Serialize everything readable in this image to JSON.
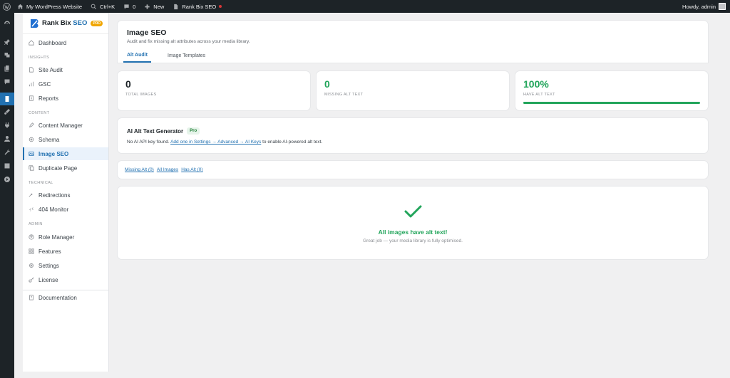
{
  "adminbar": {
    "site_name": "My WordPress Website",
    "shortcut": "Ctrl+K",
    "comments_count": "0",
    "new_label": "New",
    "plugin_label": "Rank Bix SEO",
    "howdy": "Howdy, admin"
  },
  "brand": {
    "name": "Rank Bix",
    "seo": "SEO",
    "pro": "PRO"
  },
  "sidebar": {
    "dashboard": "Dashboard",
    "section_insights": "INSIGHTS",
    "site_audit": "Site Audit",
    "gsc": "GSC",
    "reports": "Reports",
    "section_content": "CONTENT",
    "content_manager": "Content Manager",
    "schema": "Schema",
    "image_seo": "Image SEO",
    "duplicate_page": "Duplicate Page",
    "section_technical": "TECHNICAL",
    "redirections": "Redirections",
    "monitor_404": "404 Monitor",
    "section_admin": "ADMIN",
    "role_manager": "Role Manager",
    "features": "Features",
    "settings": "Settings",
    "license": "License",
    "documentation": "Documentation"
  },
  "header": {
    "title": "Image SEO",
    "subtitle": "Audit and fix missing alt attributes across your media library.",
    "tab_alt_audit": "Alt Audit",
    "tab_image_templates": "Image Templates"
  },
  "stats": {
    "total_images": {
      "value": "0",
      "label": "TOTAL IMAGES"
    },
    "missing_alt": {
      "value": "0",
      "label": "MISSING ALT TEXT"
    },
    "have_alt": {
      "value": "100%",
      "label": "HAVE ALT TEXT",
      "progress": 100
    }
  },
  "ai": {
    "title": "AI Alt Text Generator",
    "badge": "Pro",
    "text_before": "No AI API key found.",
    "link": "Add one in Settings → Advanced → AI Keys",
    "text_after": "to enable AI-powered alt text."
  },
  "filters": {
    "missing": "Missing Alt (0)",
    "all": "All Images",
    "has": "Has Alt (0)"
  },
  "empty": {
    "title": "All images have alt text!",
    "subtitle": "Great job — your media library is fully optimised."
  },
  "colors": {
    "accent": "#2271b1",
    "success": "#22a55b",
    "adminbar": "#1d2327"
  }
}
